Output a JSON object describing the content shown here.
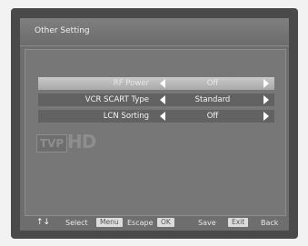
{
  "header": {
    "title": "Other Setting"
  },
  "settings": [
    {
      "label": "RF Power",
      "value": "Off"
    },
    {
      "label": "VCR SCART Type",
      "value": "Standard"
    },
    {
      "label": "LCN Sorting",
      "value": "Off"
    }
  ],
  "logo": {
    "tvp": "TVP",
    "hd": "HD"
  },
  "footer": {
    "nav_icon": "↑↓",
    "select_label": "Select",
    "menu_key": "Menu",
    "escape_label": "Escape",
    "ok_key": "OK",
    "save_label": "Save",
    "exit_key": "Exit",
    "back_label": "Back"
  }
}
